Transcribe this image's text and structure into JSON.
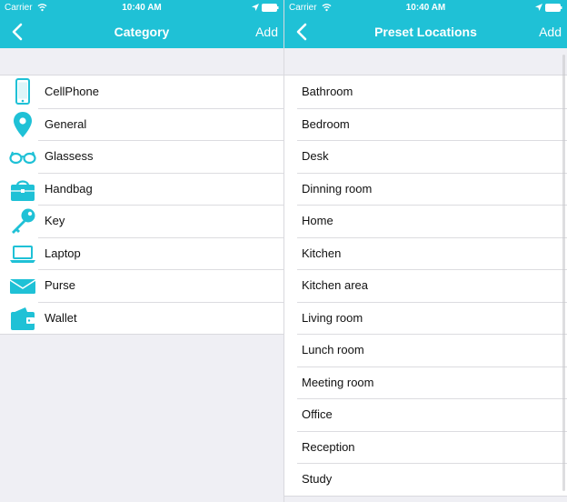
{
  "colors": {
    "accent": "#1fc1d6",
    "background": "#efeff4",
    "text": "#111111"
  },
  "statusbar": {
    "carrier": "Carrier",
    "time": "10:40 AM"
  },
  "left": {
    "title": "Category",
    "add_label": "Add",
    "items": [
      {
        "label": "CellPhone",
        "icon": "cellphone-icon"
      },
      {
        "label": "General",
        "icon": "map-pin-icon"
      },
      {
        "label": "Glassess",
        "icon": "glasses-icon"
      },
      {
        "label": "Handbag",
        "icon": "handbag-icon"
      },
      {
        "label": "Key",
        "icon": "key-icon"
      },
      {
        "label": "Laptop",
        "icon": "laptop-icon"
      },
      {
        "label": "Purse",
        "icon": "purse-icon"
      },
      {
        "label": "Wallet",
        "icon": "wallet-icon"
      }
    ]
  },
  "right": {
    "title": "Preset Locations",
    "add_label": "Add",
    "items": [
      {
        "label": "Bathroom"
      },
      {
        "label": "Bedroom"
      },
      {
        "label": "Desk"
      },
      {
        "label": "Dinning room"
      },
      {
        "label": "Home"
      },
      {
        "label": "Kitchen"
      },
      {
        "label": "Kitchen area"
      },
      {
        "label": "Living room"
      },
      {
        "label": "Lunch room"
      },
      {
        "label": "Meeting room"
      },
      {
        "label": "Office"
      },
      {
        "label": "Reception"
      },
      {
        "label": "Study"
      }
    ]
  }
}
